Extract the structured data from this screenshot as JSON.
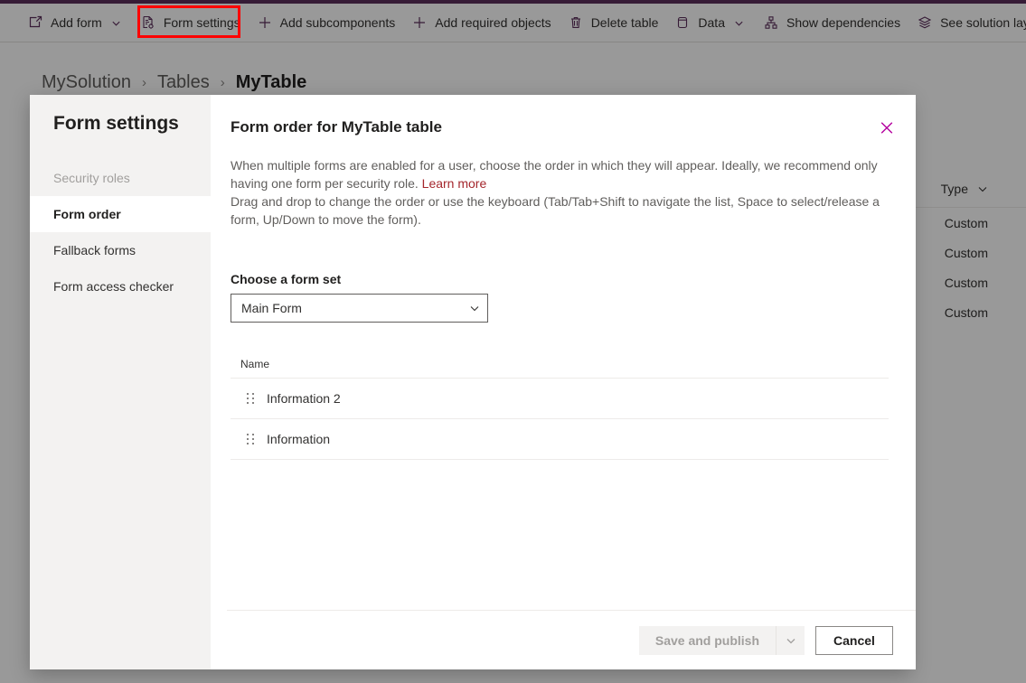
{
  "theme": {
    "accent_purple": "#5b2d5b",
    "link_red": "#a4262c",
    "highlight_red": "#ff0000"
  },
  "command_bar": {
    "items": [
      {
        "label": "Add form",
        "icon": "add-form-icon",
        "chevron": true
      },
      {
        "label": "Form settings",
        "icon": "form-settings-icon",
        "chevron": false
      },
      {
        "label": "Add subcomponents",
        "icon": "plus-icon",
        "chevron": false
      },
      {
        "label": "Add required objects",
        "icon": "plus-icon",
        "chevron": false
      },
      {
        "label": "Delete table",
        "icon": "trash-icon",
        "chevron": false
      },
      {
        "label": "Data",
        "icon": "database-icon",
        "chevron": true
      },
      {
        "label": "Show dependencies",
        "icon": "dependencies-icon",
        "chevron": false
      },
      {
        "label": "See solution layers",
        "icon": "layers-icon",
        "chevron": false
      }
    ]
  },
  "breadcrumb": {
    "items": [
      "MySolution",
      "Tables",
      "MyTable"
    ],
    "separator": "›"
  },
  "background_grid": {
    "column_header": "Type",
    "rows": [
      "Custom",
      "Custom",
      "Custom",
      "Custom"
    ]
  },
  "dialog": {
    "nav_title": "Form settings",
    "nav_items": [
      {
        "label": "Security roles",
        "state": "disabled"
      },
      {
        "label": "Form order",
        "state": "selected"
      },
      {
        "label": "Fallback forms",
        "state": "normal"
      },
      {
        "label": "Form access checker",
        "state": "normal"
      }
    ],
    "close_label": "Close",
    "heading": "Form order for MyTable table",
    "description_part1": "When multiple forms are enabled for a user, choose the order in which they will appear. Ideally, we recommend only having one form per security role. ",
    "learn_more": "Learn more",
    "description_part2": "Drag and drop to change the order or use the keyboard (Tab/Tab+Shift to navigate the list, Space to select/release a form, Up/Down to move the form).",
    "form_set_label": "Choose a form set",
    "form_set_value": "Main Form",
    "list_column_header": "Name",
    "forms": [
      {
        "name": "Information 2"
      },
      {
        "name": "Information"
      }
    ],
    "save_publish_label": "Save and publish",
    "cancel_label": "Cancel"
  }
}
